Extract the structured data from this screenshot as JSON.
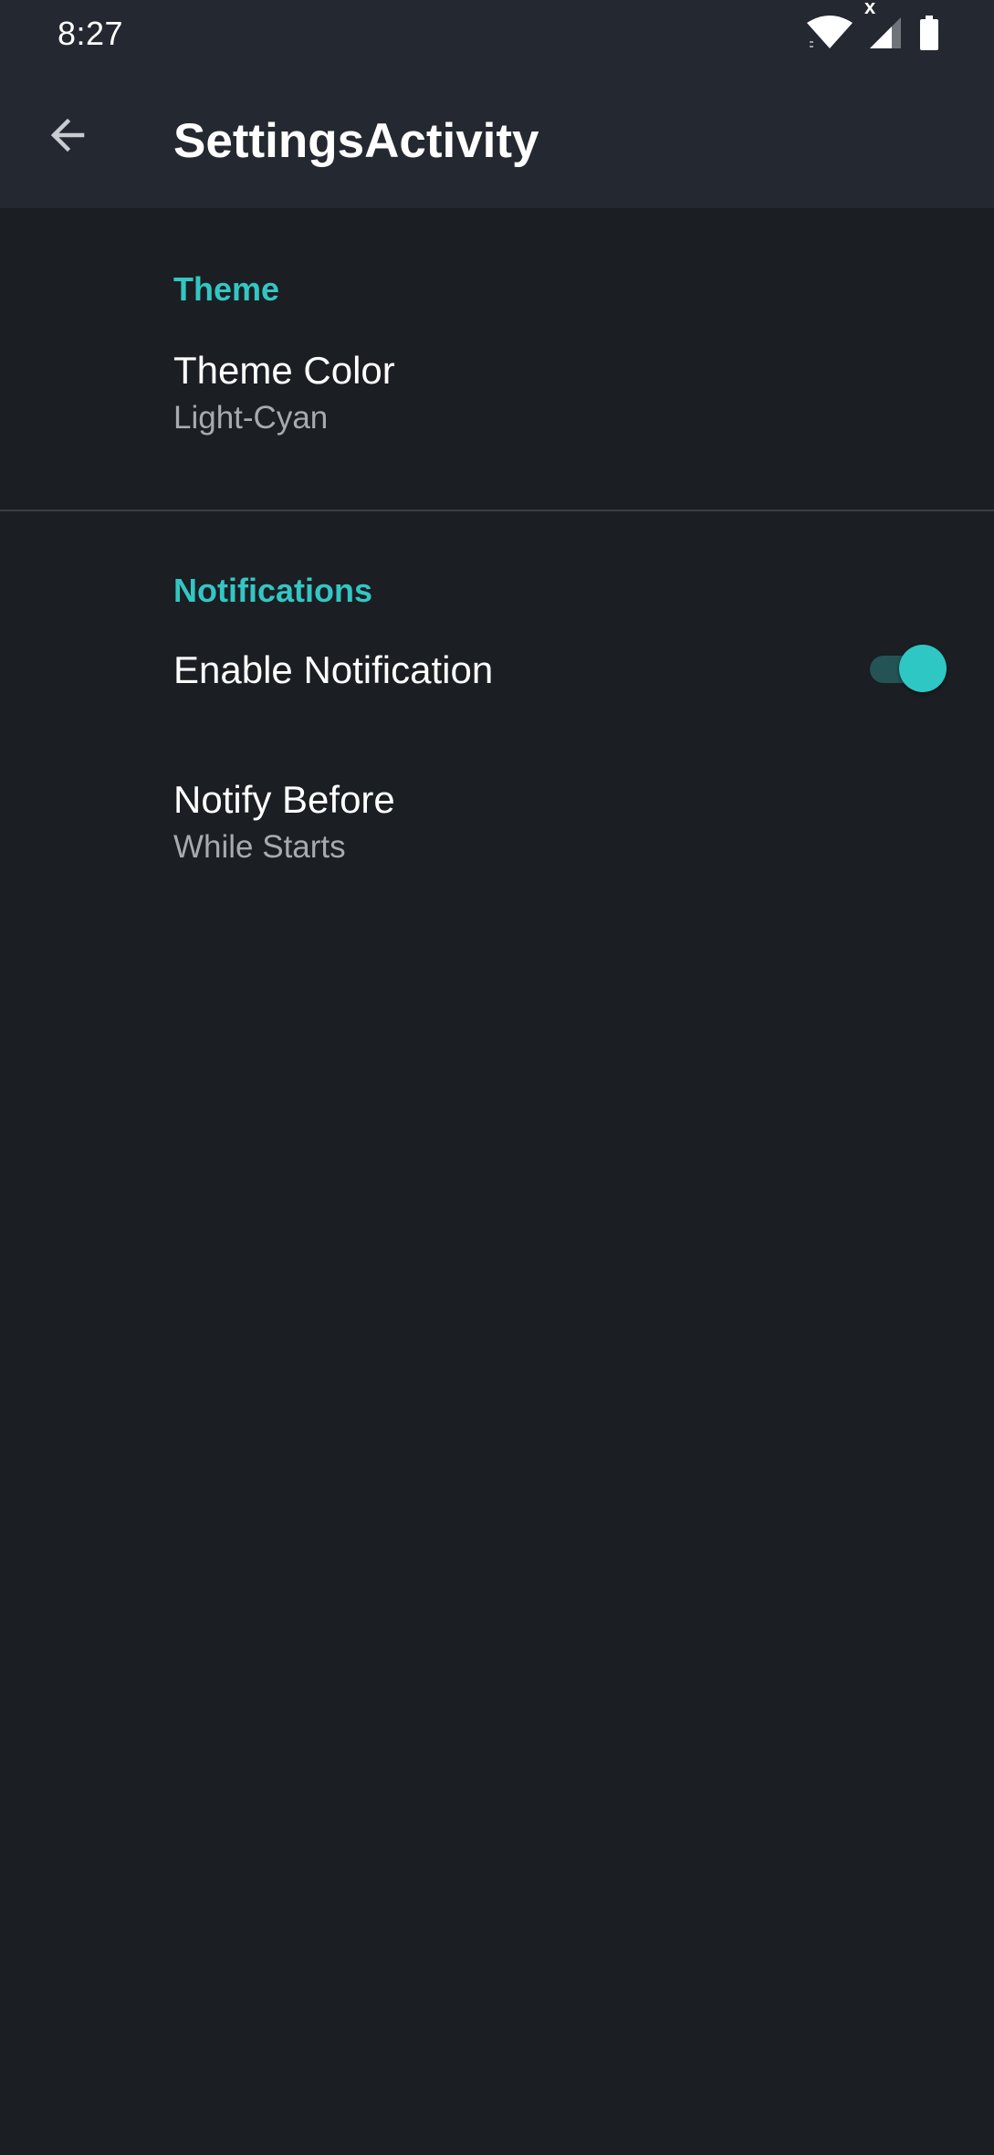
{
  "status_bar": {
    "time": "8:27",
    "icons": [
      "wifi-icon",
      "cellular-signal-icon",
      "battery-icon"
    ],
    "signal_mark": "x"
  },
  "app_bar": {
    "back_icon": "arrow-back-icon",
    "title": "SettingsActivity"
  },
  "colors": {
    "background": "#1b1e23",
    "bar": "#242831",
    "accent": "#33c6c3",
    "summary_text": "#a7abb0"
  },
  "settings": {
    "theme": {
      "category": "Theme",
      "theme_color": {
        "title": "Theme Color",
        "summary": "Light-Cyan"
      }
    },
    "notifications": {
      "category": "Notifications",
      "enable_notification": {
        "title": "Enable Notification",
        "enabled": true
      },
      "notify_before": {
        "title": "Notify Before",
        "summary": "While Starts"
      }
    }
  }
}
